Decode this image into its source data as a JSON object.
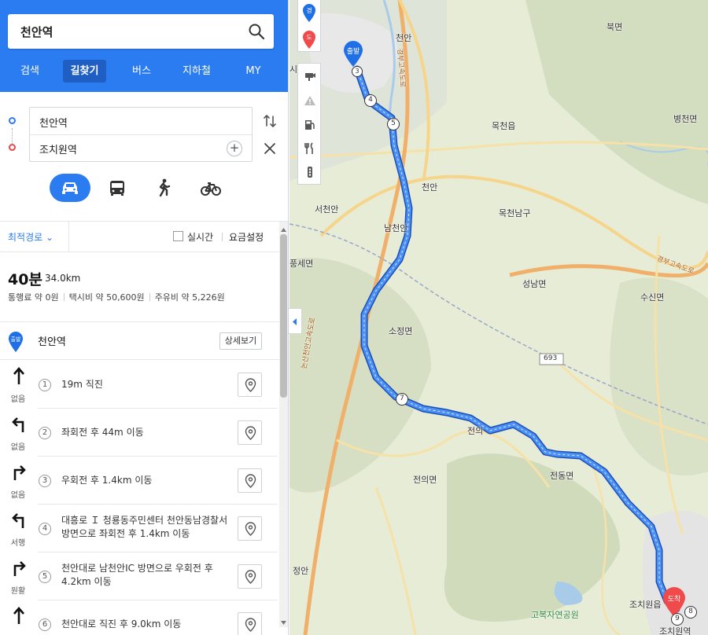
{
  "search": {
    "value": "천안역"
  },
  "nav_tabs": [
    "검색",
    "길찾기",
    "버스",
    "지하철",
    "MY"
  ],
  "route": {
    "origin": "천안역",
    "destination": "조치원역",
    "add_symbol": "+"
  },
  "options": {
    "route_type": "최적경로 ⌄",
    "realtime": "실시간",
    "fare_setting": "요금설정"
  },
  "summary": {
    "time": "40분",
    "distance": "34.0km",
    "toll": "통행료 약 0원",
    "taxi": "택시비 약 50,600원",
    "fuel": "주유비 약 5,226원"
  },
  "start": {
    "badge": "출발",
    "name": "천안역",
    "detail_label": "상세보기"
  },
  "steps": [
    {
      "num": "1",
      "direction": "straight",
      "tag": "없음",
      "text": "19m 직진"
    },
    {
      "num": "2",
      "direction": "left",
      "tag": "없음",
      "text": "좌회전 후 44m 이동"
    },
    {
      "num": "3",
      "direction": "right",
      "tag": "없음",
      "text": "우회전 후 1.4km 이동"
    },
    {
      "num": "4",
      "direction": "left",
      "tag": "서행",
      "text": "대흥로 Ｉ 청룡동주민센터 천안동남경찰서 방면으로 좌회전 후 1.4km 이동"
    },
    {
      "num": "5",
      "direction": "right",
      "tag": "원활",
      "text": "천안대로 남천안IC 방면으로 우회전 후 4.2km 이동"
    },
    {
      "num": "6",
      "direction": "straight",
      "tag": "",
      "text": "천안대로 직진 후 9.0km 이동"
    }
  ],
  "map": {
    "labels": {
      "bukmyeon": "북면",
      "byeongcheon": "병천면",
      "mokcheon": "목천읍",
      "cheonan_n": "천안",
      "cheonan_ic": "천안",
      "seocheonan": "서천안",
      "namcheonan": "남천안",
      "mokcheon_nam": "목천남구",
      "pungse": "풍세면",
      "seongnam": "성남면",
      "susin": "수신면",
      "sojeong": "소정면",
      "jeonui": "전의면",
      "jeondong": "전동면",
      "jeonui_st": "전의",
      "jochiwon": "조치원읍",
      "jochiwon_st": "조치원역",
      "gobok": "고복자연공원",
      "jeongan": "정안",
      "sirim": "시",
      "rt693": "693",
      "hw_gyeongbu": "경부고속도로",
      "hw_nonsan": "논산천안고속도로",
      "hw_dangjin": "경부고속도로"
    },
    "start_badge": "출발",
    "end_badge": "도착",
    "route_markers": [
      "3",
      "4",
      "5",
      "7",
      "9",
      "8"
    ],
    "route_color": "#3a7bf0",
    "tool_labels": {
      "origin_badge": "경",
      "dest_badge": "도"
    }
  }
}
